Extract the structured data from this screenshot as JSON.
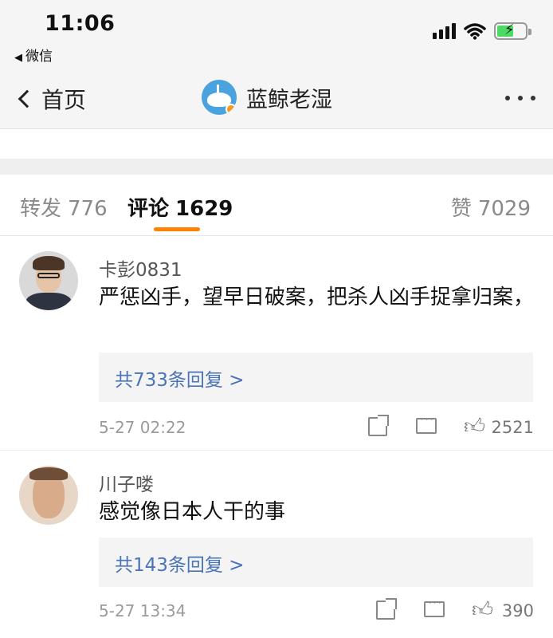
{
  "status_bar": {
    "time": "11:06",
    "back_app": "微信",
    "back_icon": "◀",
    "battery_color": "#4cd964"
  },
  "nav": {
    "back_label": "首页",
    "title": "蓝鲸老湿",
    "more_icon": "more-icon"
  },
  "tabs": {
    "repost_label": "转发",
    "repost_count": "776",
    "comment_label": "评论",
    "comment_count": "1629",
    "like_label": "赞",
    "like_count": "7029",
    "active_color": "#ff8200"
  },
  "comments": [
    {
      "username": "卡彭0831",
      "text": "严惩凶手，望早日破案，把杀人凶手捉拿归案，",
      "replies": "共733条回复 >",
      "time": "5-27 02:22",
      "likes": "2521"
    },
    {
      "username": "川子喽",
      "text": "感觉像日本人干的事",
      "replies": "共143条回复 >",
      "time": "5-27 13:34",
      "likes": "390"
    }
  ],
  "colors": {
    "link": "#4a74b8",
    "reply_bg": "#f4f4f4",
    "muted": "#9a9a9a"
  }
}
